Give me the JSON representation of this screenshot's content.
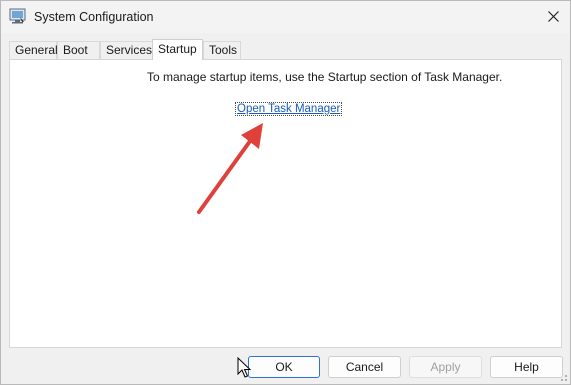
{
  "window": {
    "title": "System Configuration",
    "icon": "msconfig-app-icon"
  },
  "tabs": [
    {
      "label": "General",
      "active": false
    },
    {
      "label": "Boot",
      "active": false
    },
    {
      "label": "Services",
      "active": false
    },
    {
      "label": "Startup",
      "active": true
    },
    {
      "label": "Tools",
      "active": false
    }
  ],
  "startup": {
    "message": "To manage startup items, use the Startup section of Task Manager.",
    "link_label": "Open Task Manager"
  },
  "buttons": {
    "ok": "OK",
    "cancel": "Cancel",
    "apply": "Apply",
    "help": "Help"
  },
  "colors": {
    "link": "#1a5cb8",
    "arrow": "#e0403a",
    "primary_border": "#2f6fd6"
  }
}
